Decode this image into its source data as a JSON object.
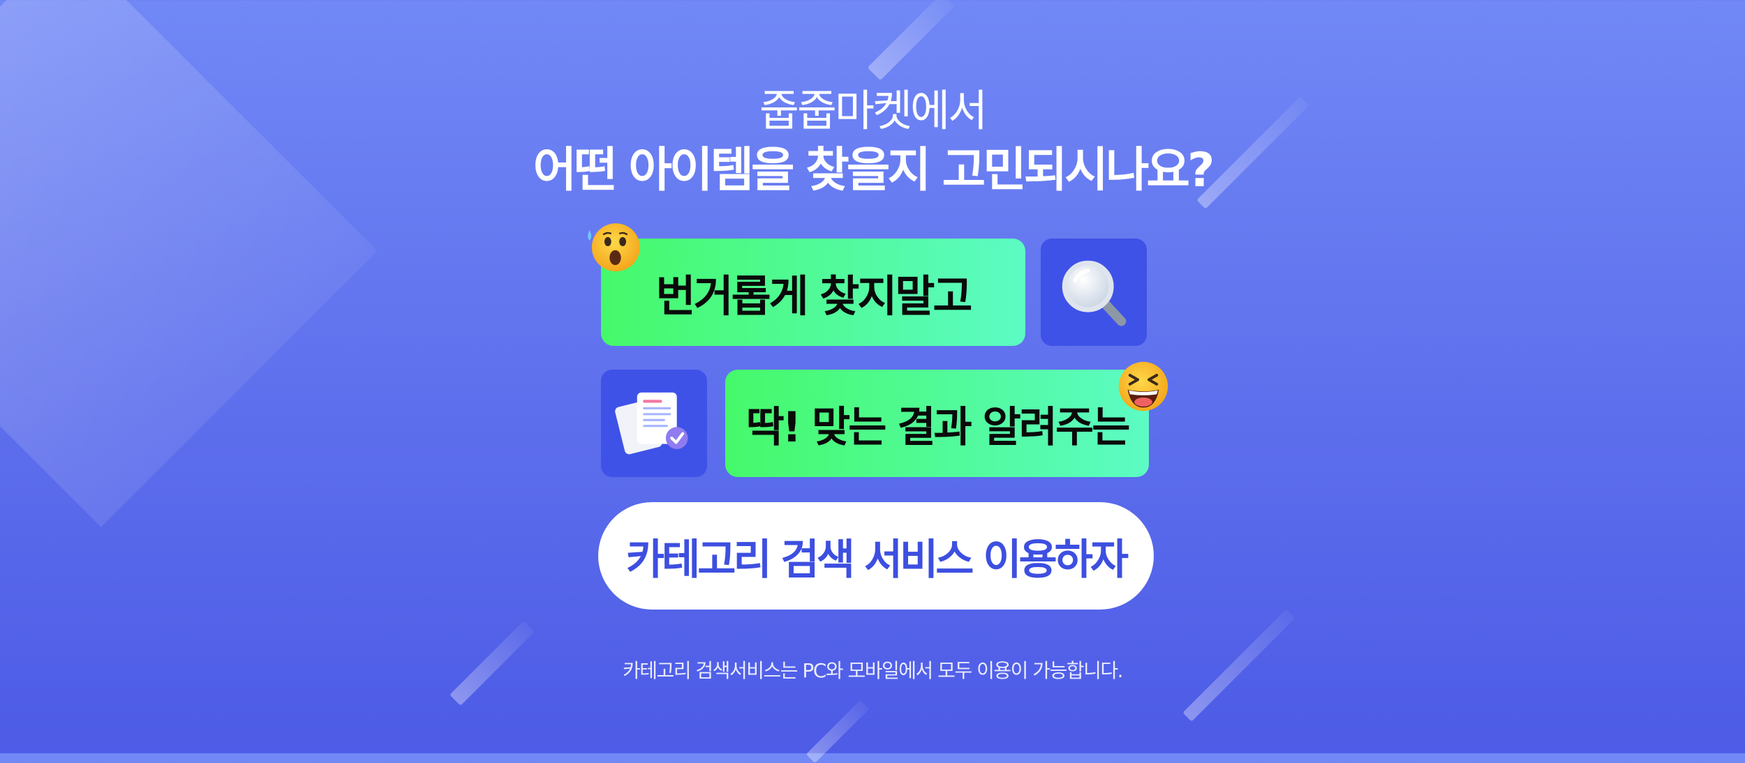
{
  "banner": {
    "heading_small": "줍줍마켓에서",
    "heading_big": "어떤 아이템을 찾을지 고민되시나요?",
    "bubble_one": "번거롭게 찾지말고",
    "bubble_two": "딱! 맞는 결과 알려주는",
    "cta_label": "카테고리 검색 서비스 이용하자",
    "footnote": "카테고리 검색서비스는  PC와 모바일에서 모두 이용이 가능합니다."
  },
  "icons": {
    "search": "magnifier-icon",
    "document": "document-check-icon",
    "emoji_one": "shocked-emoji-icon",
    "emoji_two": "laughing-emoji-icon"
  },
  "colors": {
    "background_top": "#7188f6",
    "background_bottom": "#4d5be6",
    "green_start": "#45f96a",
    "green_end": "#5cfbc4",
    "icon_box": "#3e52e8",
    "cta_text": "#3d4fe0"
  }
}
